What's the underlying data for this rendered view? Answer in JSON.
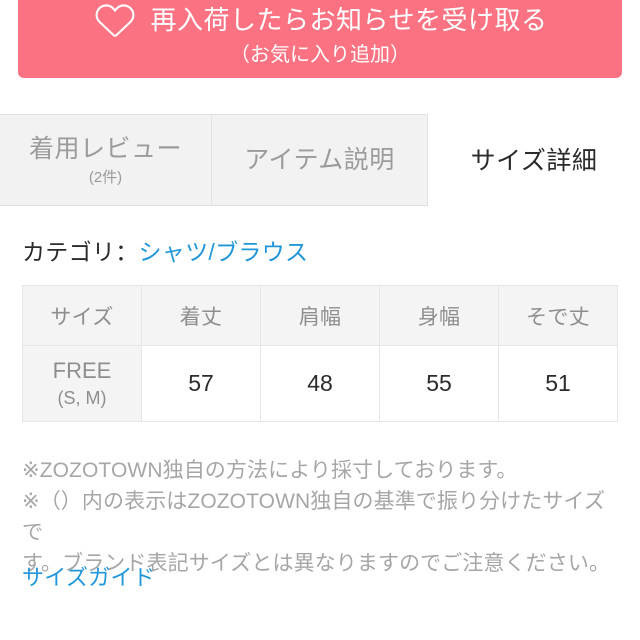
{
  "favorite_button": {
    "icon": "heart-outline-icon",
    "main_label": "再入荷したらお知らせを受け取る",
    "sub_label": "（お気に入り追加）",
    "background_color": "#fb7382",
    "text_color": "#ffffff"
  },
  "tabs": [
    {
      "key": "reviews",
      "label": "着用レビュー",
      "count_label": "(2件)",
      "active": false
    },
    {
      "key": "description",
      "label": "アイテム説明",
      "count_label": "",
      "active": false
    },
    {
      "key": "size_detail",
      "label": "サイズ詳細",
      "count_label": "",
      "active": true
    }
  ],
  "category": {
    "label": "カテゴリ：",
    "link_text": "シャツ/ブラウス",
    "link_color": "#2196d8"
  },
  "size_table": {
    "headers": [
      "サイズ",
      "着丈",
      "肩幅",
      "身幅",
      "そで丈"
    ],
    "rows": [
      {
        "size_name": "FREE",
        "size_sub": "(S, M)",
        "values": [
          "57",
          "48",
          "55",
          "51"
        ]
      }
    ]
  },
  "notes": {
    "line1": "※ZOZOTOWN独自の方法により採寸しております。",
    "line2": "※（）内の表示はZOZOTOWN独自の基準で振り分けたサイズで",
    "line3": "す。ブランド表記サイズとは異なりますのでご注意ください。"
  },
  "size_guide": {
    "label": "サイズガイド",
    "link_color": "#2196d8"
  }
}
